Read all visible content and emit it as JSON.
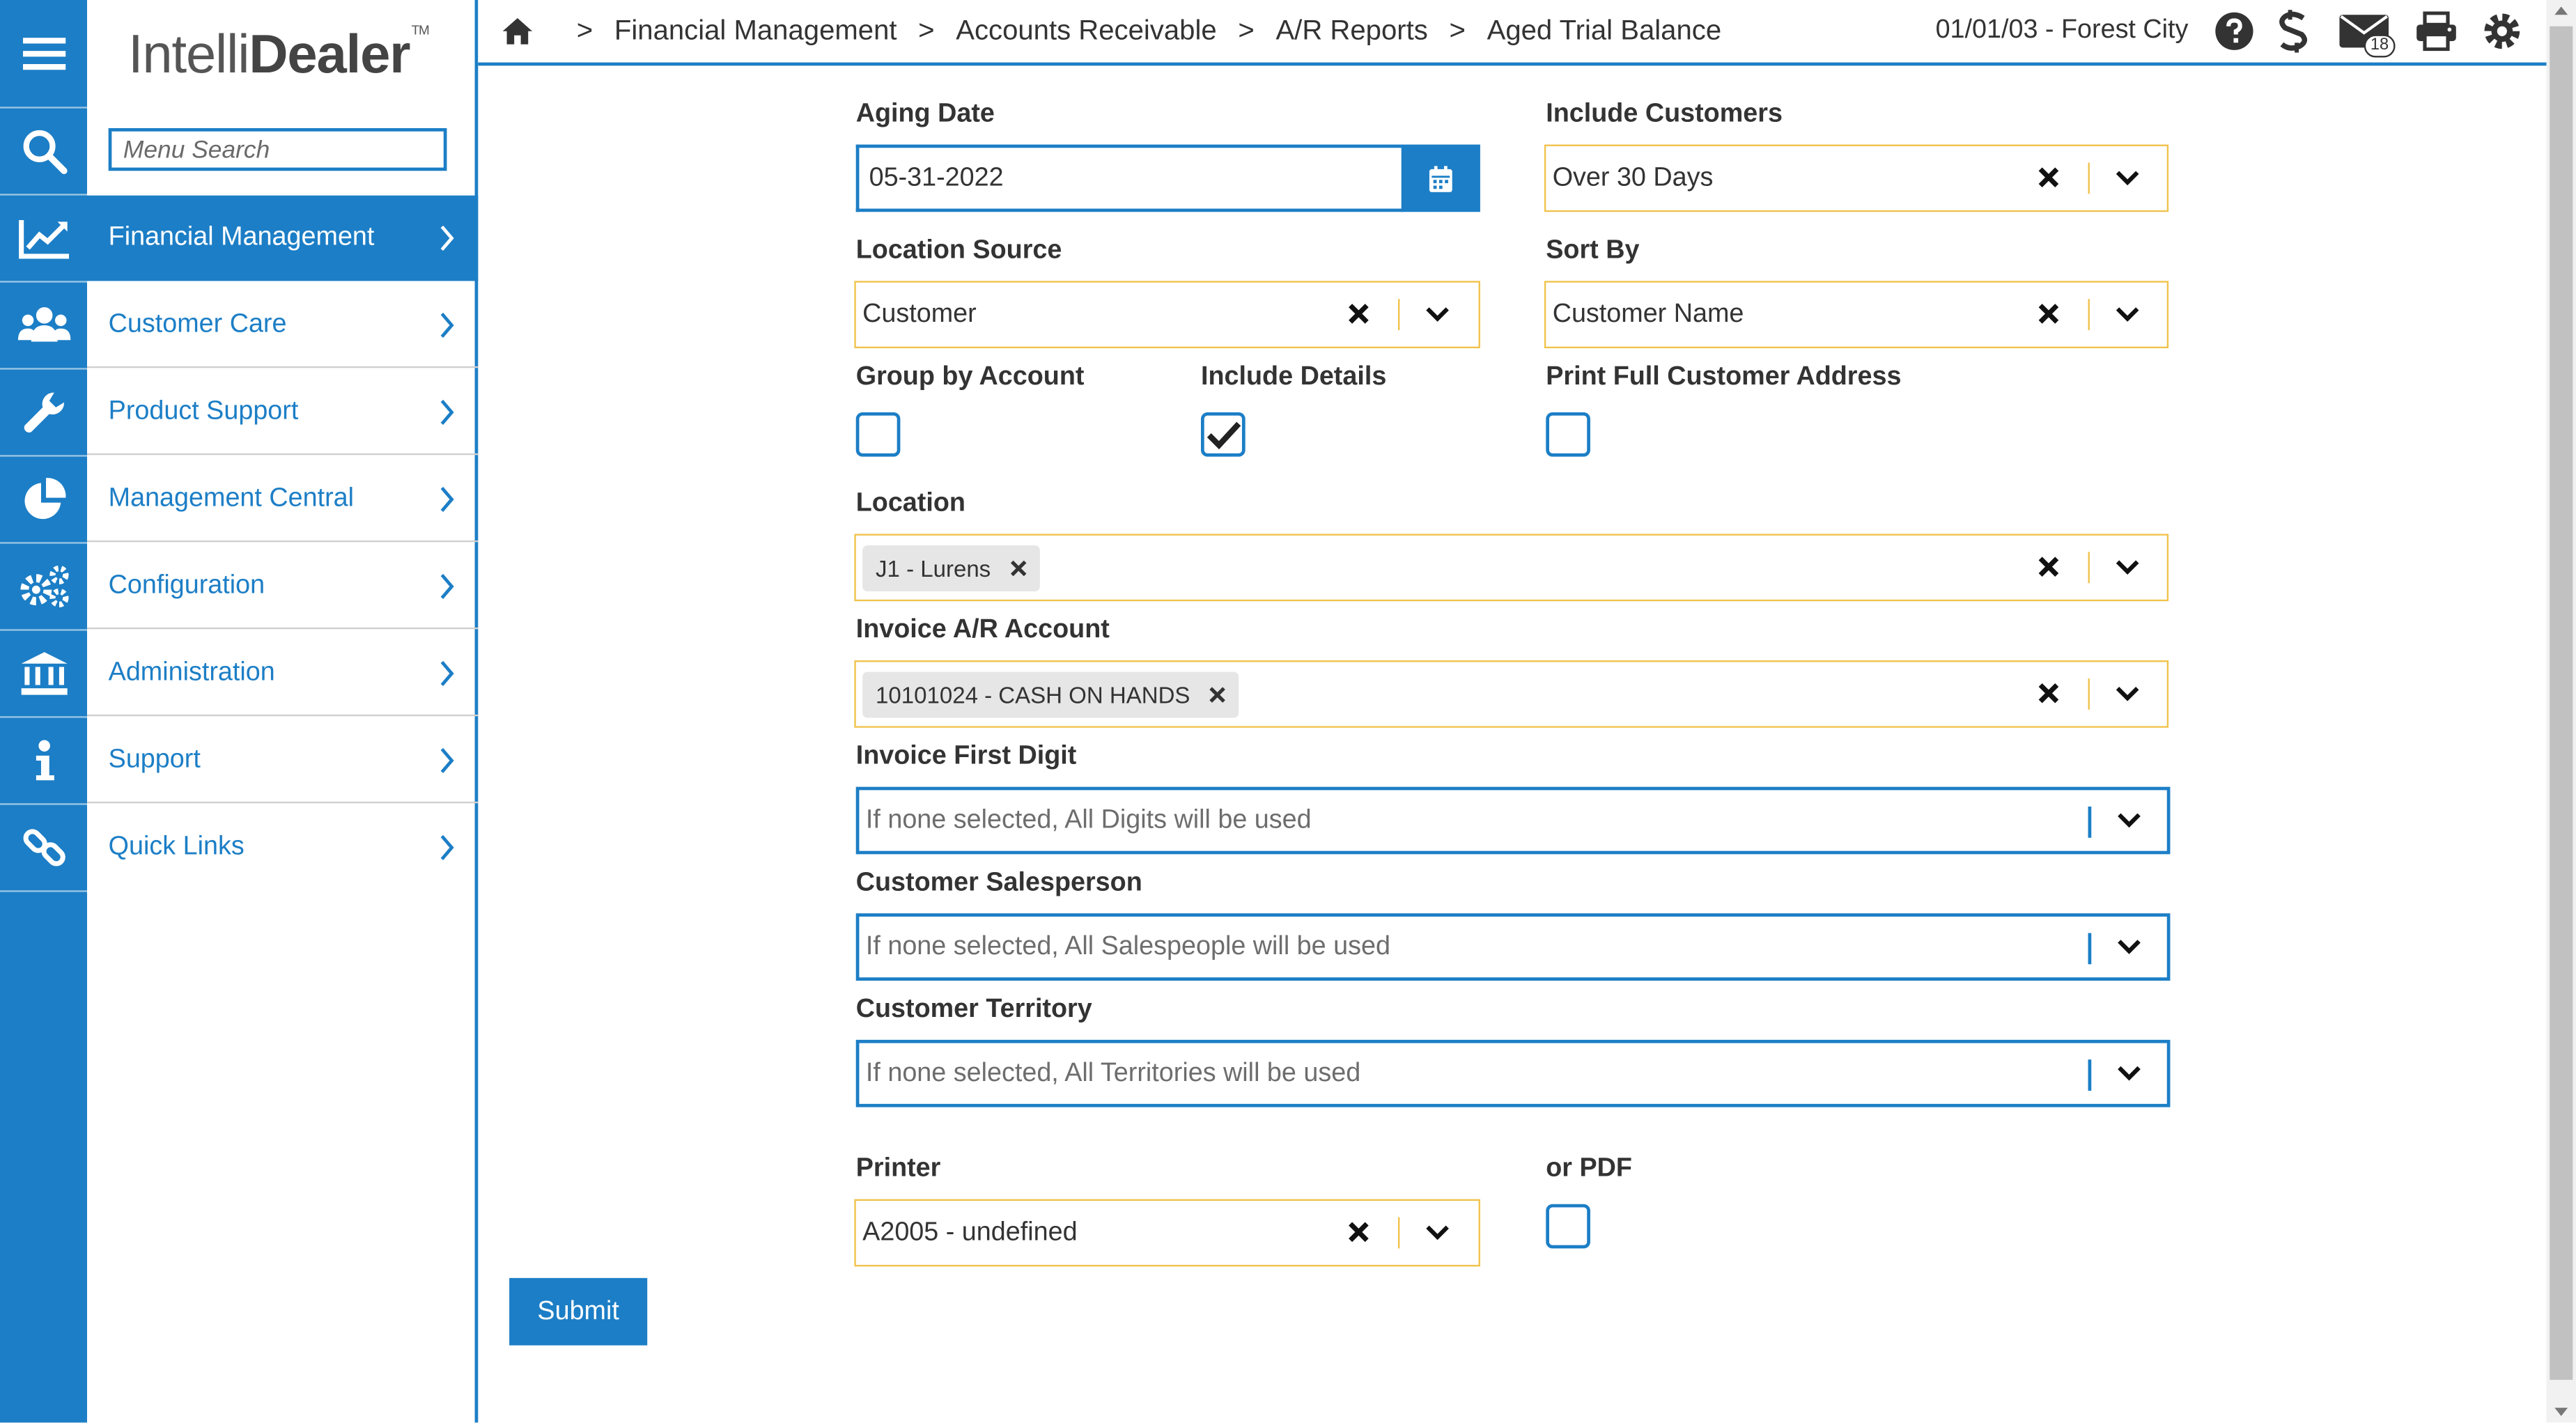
{
  "brand": {
    "light": "Intelli",
    "bold": "Dealer",
    "tm": "TM"
  },
  "sidebar": {
    "search_placeholder": "Menu Search",
    "items": [
      {
        "label": "Financial Management",
        "icon": "chart-line-icon",
        "active": true
      },
      {
        "label": "Customer Care",
        "icon": "users-icon",
        "active": false
      },
      {
        "label": "Product Support",
        "icon": "wrench-icon",
        "active": false
      },
      {
        "label": "Management Central",
        "icon": "pie-chart-icon",
        "active": false
      },
      {
        "label": "Configuration",
        "icon": "gears-icon",
        "active": false
      },
      {
        "label": "Administration",
        "icon": "bank-icon",
        "active": false
      },
      {
        "label": "Support",
        "icon": "info-icon",
        "active": false
      },
      {
        "label": "Quick Links",
        "icon": "link-icon",
        "active": false
      }
    ]
  },
  "header": {
    "breadcrumb": [
      "Financial Management",
      "Accounts Receivable",
      "A/R Reports",
      "Aged Trial Balance"
    ],
    "separator": ">",
    "context": "01/01/03 - Forest City",
    "mail_count": "18",
    "icons": [
      "home-icon",
      "help-icon",
      "dollar-icon",
      "mail-icon",
      "print-icon",
      "gear-icon"
    ]
  },
  "form": {
    "aging_date": {
      "label": "Aging Date",
      "value": "05-31-2022"
    },
    "include_customers": {
      "label": "Include Customers",
      "value": "Over 30 Days"
    },
    "location_source": {
      "label": "Location Source",
      "value": "Customer"
    },
    "sort_by": {
      "label": "Sort By",
      "value": "Customer Name"
    },
    "group_by_account": {
      "label": "Group by Account",
      "checked": false
    },
    "include_details": {
      "label": "Include Details",
      "checked": true
    },
    "print_full_address": {
      "label": "Print Full Customer Address",
      "checked": false
    },
    "location": {
      "label": "Location",
      "chips": [
        "J1 - Lurens"
      ]
    },
    "invoice_ar_account": {
      "label": "Invoice A/R Account",
      "chips": [
        "10101024 - CASH ON HANDS"
      ]
    },
    "invoice_first_digit": {
      "label": "Invoice First Digit",
      "placeholder": "If none selected, All Digits will be used"
    },
    "customer_salesperson": {
      "label": "Customer Salesperson",
      "placeholder": "If none selected, All Salespeople will be used"
    },
    "customer_territory": {
      "label": "Customer Territory",
      "placeholder": "If none selected, All Territories will be used"
    },
    "printer": {
      "label": "Printer",
      "value": "A2005 - undefined"
    },
    "or_pdf": {
      "label": "or PDF",
      "checked": false
    },
    "submit_label": "Submit"
  },
  "colors": {
    "accent": "#1c7ec6",
    "warning_border": "#f0c24b",
    "chip_bg": "#e6e6e6"
  }
}
